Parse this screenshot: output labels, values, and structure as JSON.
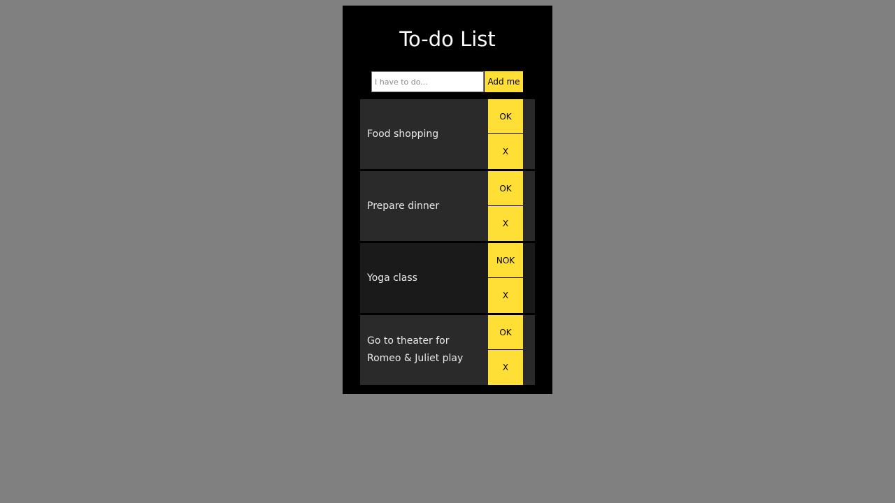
{
  "app": {
    "title": "To-do List",
    "input_placeholder": "I have to do...",
    "input_value": "",
    "add_label": "Add me"
  },
  "items": [
    {
      "text": "Food shopping",
      "toggle_label": "OK",
      "delete_label": "X",
      "done": false
    },
    {
      "text": "Prepare dinner",
      "toggle_label": "OK",
      "delete_label": "X",
      "done": false
    },
    {
      "text": "Yoga class",
      "toggle_label": "NOK",
      "delete_label": "X",
      "done": true
    },
    {
      "text": "Go to theater for Romeo & Juliet play",
      "toggle_label": "OK",
      "delete_label": "X",
      "done": false
    }
  ],
  "colors": {
    "accent": "#ffde35",
    "row_bg": "#2a2a2a",
    "row_done_bg": "#1a1a1a",
    "card_bg": "#000000",
    "page_bg": "#808080"
  }
}
